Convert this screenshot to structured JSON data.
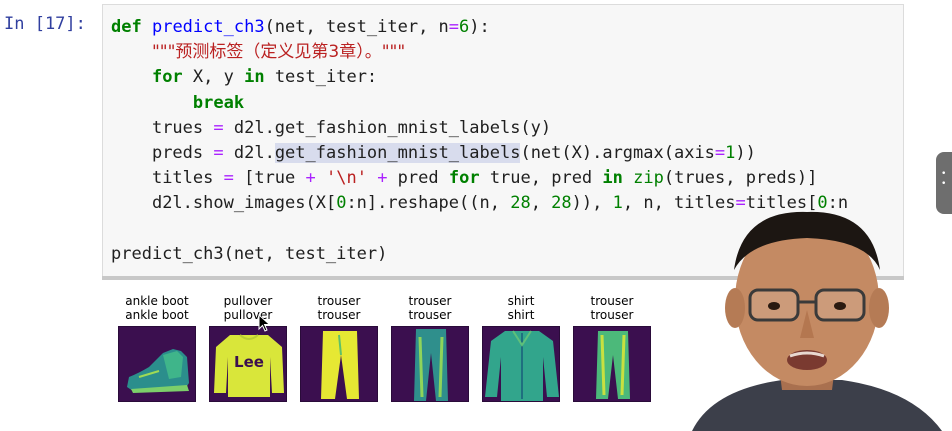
{
  "cell": {
    "prompt": "In [17]:",
    "code": {
      "l1": {
        "def": "def",
        "fname": "predict_ch3",
        "args_open": "(net, test_iter, n",
        "eq": "=",
        "n": "6",
        "args_close": "):"
      },
      "l2": {
        "docstring": "\"\"\"预测标签（定义见第3章）。\"\"\""
      },
      "l3": {
        "for": "for",
        "vars": " X, y ",
        "in": "in",
        "rest": " test_iter:"
      },
      "l4": {
        "break": "break"
      },
      "l5": {
        "a": "trues ",
        "eq": "=",
        "b": " d2l.get_fashion_mnist_labels(y)"
      },
      "l6": {
        "a": "preds ",
        "eq": "=",
        "b": " d2l.",
        "hl": "get_fashion_mnist_labels",
        "c": "(net(X).argmax(axis",
        "eq2": "=",
        "one": "1",
        "d": "))"
      },
      "l7": {
        "a": "titles ",
        "eq": "=",
        "b": " [true ",
        "plus1": "+",
        "str": " '\\n' ",
        "plus2": "+",
        "c": " pred ",
        "for": "for",
        "d": " true, pred ",
        "in": "in",
        "zip": " zip",
        "e": "(trues, preds)]"
      },
      "l8": {
        "a": "d2l.show_images(X[",
        "z": "0",
        "b": ":n].reshape((n, ",
        "n28a": "28",
        "c": ", ",
        "n28b": "28",
        "d": ")), ",
        "one": "1",
        "e": ", n, titles",
        "eq": "=",
        "f": "titles[",
        "z2": "0",
        "g": ":n"
      },
      "l10": {
        "call": "predict_ch3(net, test_iter)"
      }
    }
  },
  "output": {
    "images": [
      {
        "true_label": "ankle boot",
        "pred_label": "ankle boot",
        "icon": "ankle-boot-image"
      },
      {
        "true_label": "pullover",
        "pred_label": "pullover",
        "icon": "pullover-image"
      },
      {
        "true_label": "trouser",
        "pred_label": "trouser",
        "icon": "trouser-image"
      },
      {
        "true_label": "trouser",
        "pred_label": "trouser",
        "icon": "trouser-image"
      },
      {
        "true_label": "shirt",
        "pred_label": "shirt",
        "icon": "shirt-image"
      },
      {
        "true_label": "trouser",
        "pred_label": "trouser",
        "icon": "trouser-image"
      }
    ],
    "sweater_print": "Lee"
  },
  "colors": {
    "prompt": "#303f9f",
    "keyword": "#008000",
    "function": "#0000ff",
    "operator": "#aa22ff",
    "string": "#ba2121",
    "image_bg": "#3b0f4f",
    "item_light": "#d9e63a",
    "item_mid": "#32a58c"
  }
}
